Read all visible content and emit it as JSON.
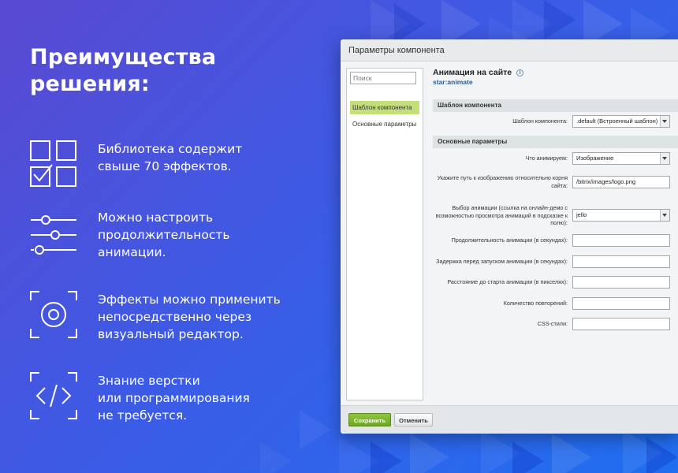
{
  "headline": "Преимущества\nрешения:",
  "features": [
    {
      "icon": "checklist-grid-icon",
      "text": "Библиотека содержит\nсвыше 70 эффектов."
    },
    {
      "icon": "sliders-icon",
      "text": "Можно настроить\nпродолжительность\nанимации."
    },
    {
      "icon": "target-frame-icon",
      "text": "Эффекты можно применить\nнепосредственно через\nвизуальный редактор."
    },
    {
      "icon": "code-frame-icon",
      "text": "Знание верстки\nили программирования\nне требуется."
    }
  ],
  "dialog": {
    "title": "Параметры компонента",
    "search_placeholder": "Поиск",
    "nav": [
      "Шаблон компонента",
      "Основные параметры"
    ],
    "component_title": "Анимация на сайте",
    "component_id": "star:animate",
    "info_icon": "i",
    "section_template": "Шаблон компонента",
    "template_label": "Шаблон компонента:",
    "template_value": ".default (Встроенный шаблон)",
    "section_main": "Основные параметры",
    "fields": [
      {
        "label": "Что анимируем:",
        "value": "Изображение",
        "type": "select"
      },
      {
        "label": "Укажите путь к изображению относительно корня сайта:",
        "value": "/bitrix/images/logo.png",
        "type": "input"
      },
      {
        "label": "Выбор анимации (ссылка на онлайн-демо с возможностью просмотра анимаций в подсказке к полю):",
        "value": "jello",
        "type": "select"
      },
      {
        "label": "Продолжительность анимации (в секундах):",
        "value": "",
        "type": "input"
      },
      {
        "label": "Задержка перед запуском анимации (в секундах):",
        "value": "",
        "type": "input"
      },
      {
        "label": "Расстояние до старта анимации (в пикселях):",
        "value": "",
        "type": "input"
      },
      {
        "label": "Количество повторений:",
        "value": "",
        "type": "input"
      },
      {
        "label": "CSS-стили:",
        "value": "",
        "type": "input"
      }
    ],
    "save_label": "Сохранить",
    "cancel_label": "Отменить"
  },
  "colors": {
    "accent_green": "#7ab42e",
    "nav_active": "#c4df7a"
  }
}
